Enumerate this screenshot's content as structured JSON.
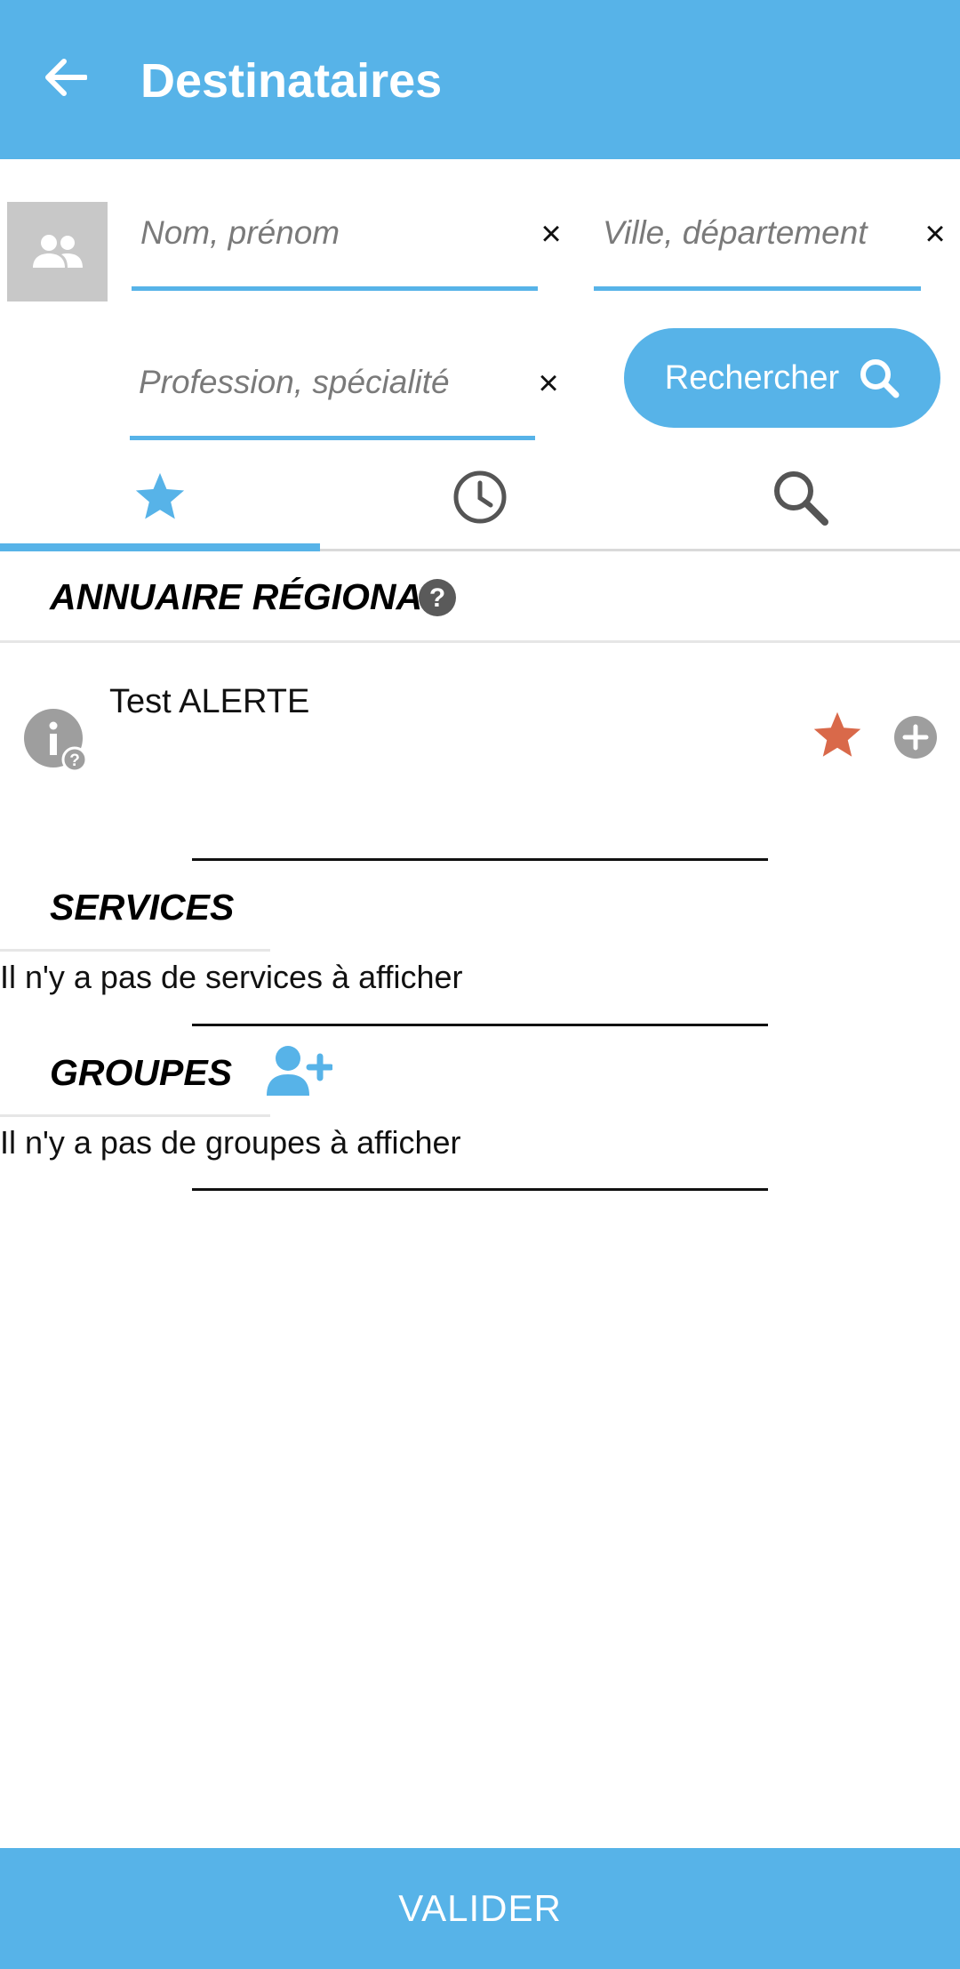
{
  "appbar": {
    "title": "Destinataires",
    "back_icon": "arrow-left-icon"
  },
  "search": {
    "name_placeholder": "Nom, prénom",
    "city_placeholder": "Ville, département",
    "profession_placeholder": "Profession, spécialité",
    "clear_symbol": "×",
    "button_label": "Rechercher"
  },
  "tabs": [
    {
      "icon": "star-icon",
      "active": true
    },
    {
      "icon": "clock-icon",
      "active": false
    },
    {
      "icon": "search-icon",
      "active": false
    }
  ],
  "annuaire": {
    "heading": "ANNUAIRE RÉGIONAL",
    "contacts": [
      {
        "name": "Test ALERTE",
        "favorite": true
      }
    ]
  },
  "services": {
    "heading": "SERVICES",
    "empty_text": "Il n'y a pas de services à afficher"
  },
  "groupes": {
    "heading": "GROUPES",
    "empty_text": "Il n'y a pas de groupes à afficher"
  },
  "footer": {
    "validate_label": "VALIDER"
  },
  "colors": {
    "primary": "#57b3e8",
    "favorite": "#d9694a",
    "muted": "#9e9e9e"
  }
}
